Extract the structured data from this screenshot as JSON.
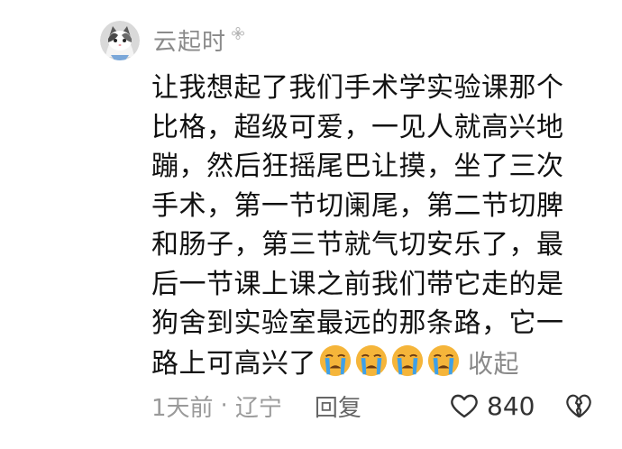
{
  "comment": {
    "username": "云起时",
    "text_lines": [
      "让我想起了我们手术学实验课那个",
      "比格，超级可爱，一见人就高兴地",
      "蹦，然后狂摇尾巴让摸，坐了三次",
      "手术，第一节切阑尾，第二节切脾",
      "和肠子，第三节就气切安乐了，最",
      "后一节课上课之前我们带它走的是",
      "狗舍到实验室最远的那条路，它一",
      "路上可高兴了"
    ],
    "emojis": [
      "crying-face",
      "crying-face",
      "crying-face",
      "crying-face"
    ],
    "collapse_label": "收起",
    "time": "1天前",
    "separator": "·",
    "location": "辽宁",
    "reply_label": "回复",
    "like_count": "840"
  },
  "colors": {
    "meta_gray": "#9a9a9a",
    "text": "#111111",
    "emoji_face": "#f5b53a",
    "emoji_tear": "#3ea0e8"
  }
}
